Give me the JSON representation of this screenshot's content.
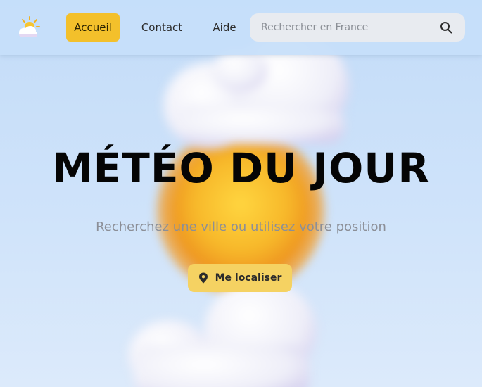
{
  "nav": {
    "home_label": "Accueil",
    "contact_label": "Contact",
    "help_label": "Aide"
  },
  "search": {
    "placeholder": "Rechercher en France",
    "value": ""
  },
  "hero": {
    "title": "MÉTÉO DU JOUR",
    "subtitle": "Recherchez une ville ou utilisez votre position",
    "locate_label": "Me localiser"
  },
  "colors": {
    "accent": "#f3c02b",
    "button": "#f5d262",
    "background": "#c3dcf8"
  },
  "icons": {
    "logo": "sun-cloud-icon",
    "search": "search-icon",
    "locate": "map-pin-icon"
  }
}
